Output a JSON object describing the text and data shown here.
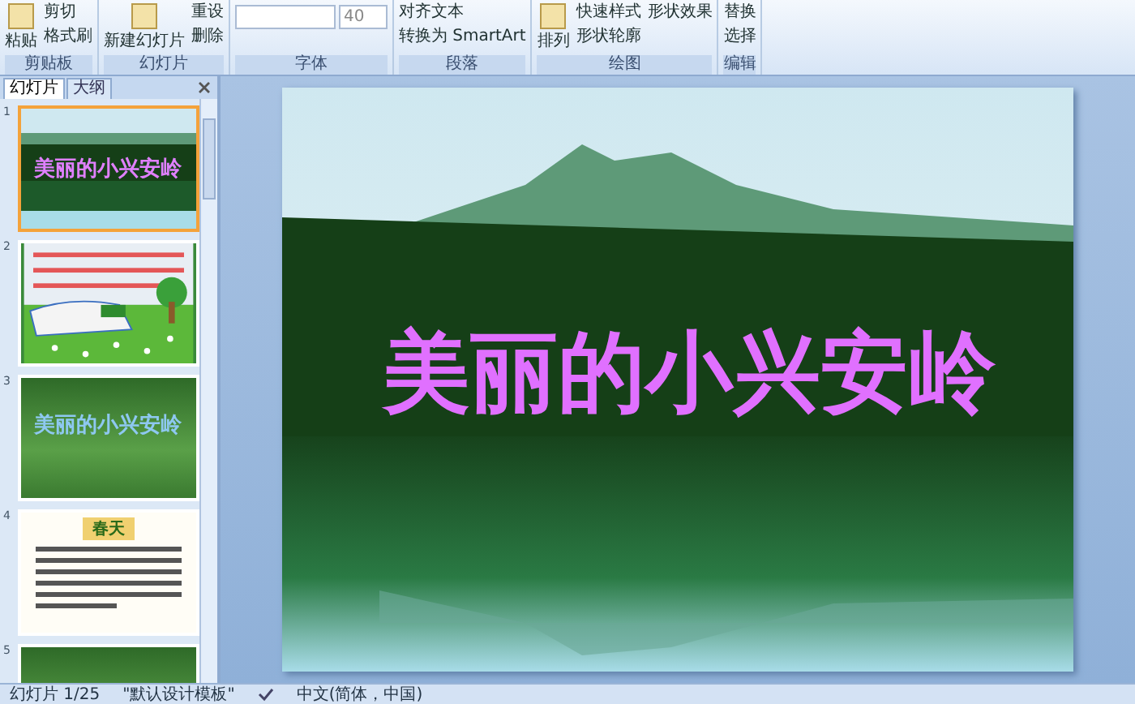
{
  "ribbon": {
    "groups": [
      {
        "label": "剪贴板",
        "items": [
          {
            "kind": "large",
            "text": "粘贴"
          },
          {
            "kind": "small",
            "text": "剪切"
          },
          {
            "kind": "small",
            "text": "格式刷"
          }
        ]
      },
      {
        "label": "幻灯片",
        "items": [
          {
            "kind": "large",
            "text": "新建幻灯片"
          },
          {
            "kind": "small",
            "text": "重设"
          },
          {
            "kind": "small",
            "text": "删除"
          }
        ]
      },
      {
        "label": "字体",
        "items": [
          {
            "kind": "field",
            "text": "40"
          }
        ]
      },
      {
        "label": "段落",
        "items": [
          {
            "kind": "small",
            "text": "对齐文本"
          },
          {
            "kind": "small",
            "text": "转换为 SmartArt"
          }
        ]
      },
      {
        "label": "绘图",
        "items": [
          {
            "kind": "large",
            "text": "排列"
          },
          {
            "kind": "small",
            "text": "快速样式"
          },
          {
            "kind": "small",
            "text": "形状轮廓"
          },
          {
            "kind": "small",
            "text": "形状效果"
          }
        ]
      },
      {
        "label": "编辑",
        "items": [
          {
            "kind": "small",
            "text": "替换"
          },
          {
            "kind": "small",
            "text": "选择"
          }
        ]
      }
    ]
  },
  "pane_tabs": [
    {
      "label": "幻灯片",
      "selected": true
    },
    {
      "label": "大纲",
      "selected": false
    }
  ],
  "slides": [
    {
      "number": "1",
      "kind": "title-photo",
      "title": "美丽的小兴安岭",
      "selected": true
    },
    {
      "number": "2",
      "kind": "cartoon",
      "selected": false
    },
    {
      "number": "3",
      "kind": "title-forest",
      "title": "美丽的小兴安岭",
      "selected": false
    },
    {
      "number": "4",
      "kind": "text",
      "heading": "春天",
      "selected": false
    },
    {
      "number": "5",
      "kind": "photo",
      "selected": false
    }
  ],
  "slide": {
    "title": "美丽的小兴安岭"
  },
  "status_bar": {
    "slide_position": "幻灯片 1/25",
    "theme": "\"默认设计模板\"",
    "language": "中文(简体，中国)"
  }
}
